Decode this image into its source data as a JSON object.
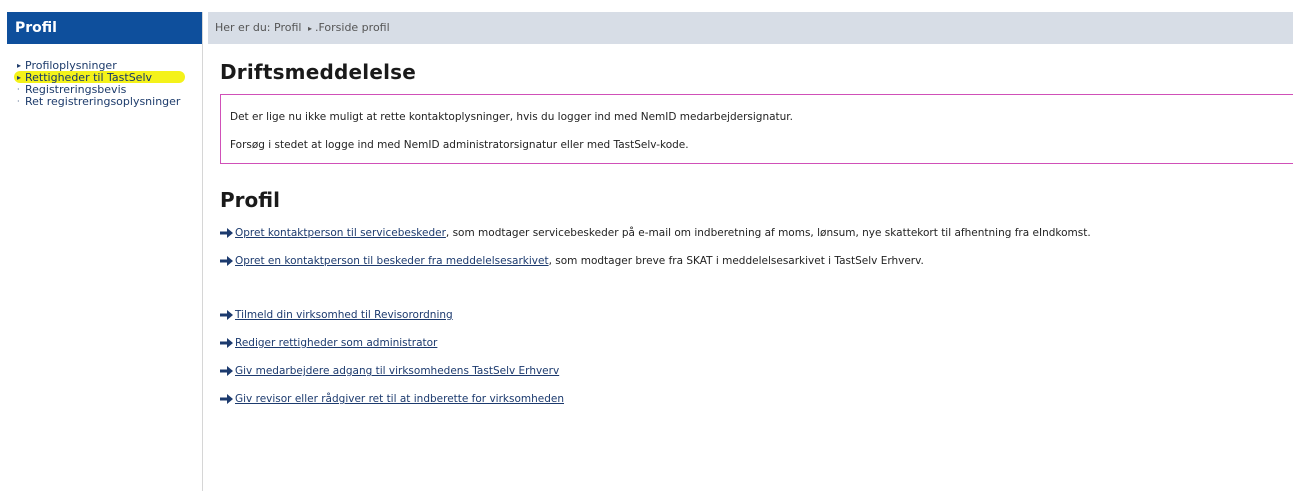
{
  "sidebar": {
    "title": "Profil",
    "items": [
      {
        "label": "Profiloplysninger",
        "bullet": "▸"
      },
      {
        "label": "Rettigheder til TastSelv",
        "bullet": "▸"
      },
      {
        "label": "Registreringsbevis",
        "bullet": "·"
      },
      {
        "label": "Ret registreringsoplysninger",
        "bullet": "·"
      }
    ]
  },
  "breadcrumb": {
    "prefix": "Her er du:",
    "items": [
      "Profil",
      ".Forside profil"
    ],
    "separator": "▸"
  },
  "notice": {
    "heading": "Driftsmeddelelse",
    "line1": "Det er lige nu ikke muligt at rette kontaktoplysninger, hvis du logger ind med NemID medarbejdersignatur.",
    "line2": "Forsøg i stedet at logge ind med NemID administratorsignatur eller med TastSelv-kode."
  },
  "profil": {
    "heading": "Profil",
    "links": [
      {
        "link_text": "Opret kontaktperson til servicebeskeder",
        "suffix": ", som modtager servicebeskeder på  e-mail om indberetning af moms, lønsum, nye skattekort til afhentning fra eIndkomst."
      },
      {
        "link_text": "Opret en kontaktperson til beskeder fra meddelelsesarkivet",
        "suffix": ", som modtager breve fra SKAT i meddelelsesarkivet i TastSelv Erhverv."
      },
      {
        "link_text": "Tilmeld din virksomhed til Revisorordning",
        "suffix": ""
      },
      {
        "link_text": "Rediger rettigheder som administrator",
        "suffix": ""
      },
      {
        "link_text": "Giv medarbejdere adgang til virksomhedens TastSelv Erhverv",
        "suffix": ""
      },
      {
        "link_text": "Giv revisor eller rådgiver ret til at indberette for virksomheden",
        "suffix": ""
      }
    ]
  },
  "colors": {
    "sidebar_header": "#0e4f9c",
    "breadcrumb_bar": "#d7dde6",
    "notice_border": "#d050b8",
    "highlight": "#f4f21a",
    "arrow_icon": "#1c3a6e"
  },
  "icons": {
    "link_arrow": "arrow-right-icon"
  }
}
